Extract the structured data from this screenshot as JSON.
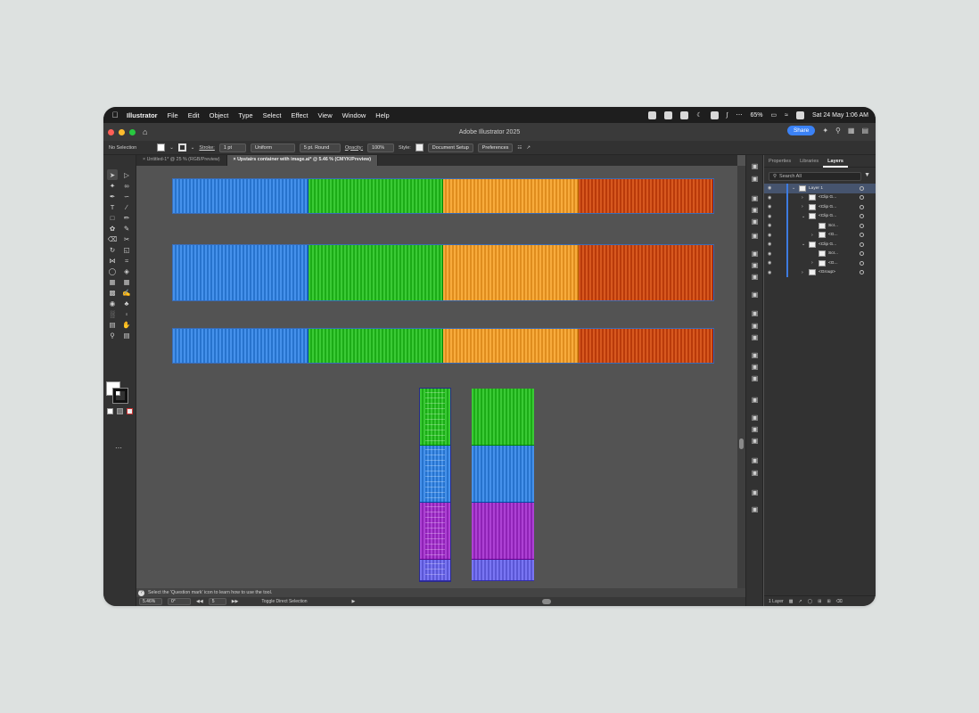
{
  "menubar": {
    "app_name": "Illustrator",
    "menus": [
      "File",
      "Edit",
      "Object",
      "Type",
      "Select",
      "Effect",
      "View",
      "Window",
      "Help"
    ],
    "battery": "65%",
    "datetime": "Sat 24 May  1:06 AM"
  },
  "titlebar": {
    "title": "Adobe Illustrator 2025",
    "share_label": "Share"
  },
  "controlbar": {
    "selection": "No Selection",
    "stroke_label": "Stroke:",
    "stroke_weight": "1 pt",
    "profile": "Uniform",
    "brush": "5 pt. Round",
    "opacity_label": "Opacity:",
    "opacity_value": "100%",
    "style_label": "Style:",
    "document_setup": "Document Setup",
    "preferences": "Preferences"
  },
  "tabs": [
    {
      "label": "Untitled-1* @ 25 % (RGB/Preview)",
      "active": false
    },
    {
      "label": "Upstairs container with image.ai* @ 5.46 % (CMYK/Preview)",
      "active": true
    }
  ],
  "canvas": {
    "colors": {
      "blue": "#3a86e0",
      "green": "#2fbf2a",
      "orange": "#f2a031",
      "red": "#cc4d14",
      "purple": "#a236c9",
      "violet": "#6e6ae8"
    },
    "horizontal_rows": [
      [
        "blue",
        "green",
        "orange",
        "red"
      ],
      [
        "blue",
        "green",
        "orange",
        "red"
      ],
      [
        "blue",
        "green",
        "orange",
        "red"
      ]
    ],
    "vertical_columns": [
      [
        "green",
        "blue",
        "purple",
        "violet"
      ],
      [
        "green",
        "blue",
        "purple",
        "violet"
      ]
    ]
  },
  "statusbar": {
    "hint": "Select the 'Question mark' icon to learn how to use the tool.",
    "zoom": "5.46%",
    "rotation": "0°",
    "artboard": "5",
    "tool_name": "Toggle Direct Selection"
  },
  "layers_panel": {
    "tabs": [
      "Properties",
      "Libraries",
      "Layers"
    ],
    "active_tab": "Layers",
    "search_placeholder": "Search All",
    "rows": [
      {
        "name": "Layer 1",
        "indent": 0,
        "twirl": "v",
        "selected": true
      },
      {
        "name": "<Clip G...",
        "indent": 1,
        "twirl": ">",
        "selected": false
      },
      {
        "name": "<Clip G...",
        "indent": 1,
        "twirl": ">",
        "selected": false
      },
      {
        "name": "<Clip G...",
        "indent": 1,
        "twirl": "v",
        "selected": false
      },
      {
        "name": "Scr...",
        "indent": 2,
        "twirl": "",
        "selected": false
      },
      {
        "name": "<G...",
        "indent": 2,
        "twirl": ">",
        "selected": false
      },
      {
        "name": "<Clip G...",
        "indent": 1,
        "twirl": "v",
        "selected": false
      },
      {
        "name": "Scr...",
        "indent": 2,
        "twirl": "",
        "selected": false
      },
      {
        "name": "<G...",
        "indent": 2,
        "twirl": ">",
        "selected": false
      },
      {
        "name": "<Group>",
        "indent": 1,
        "twirl": ">",
        "selected": false
      }
    ],
    "footer": "1 Layer"
  }
}
